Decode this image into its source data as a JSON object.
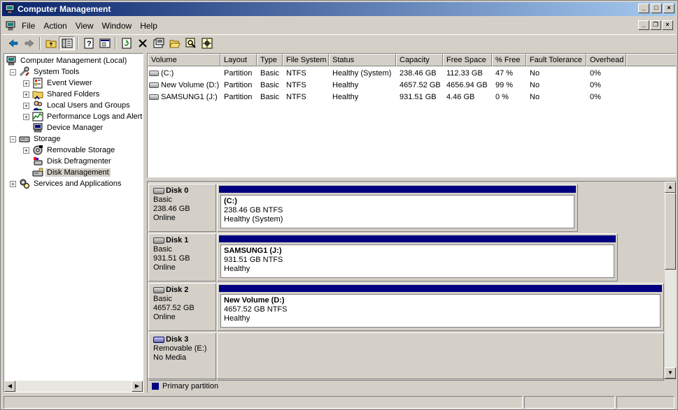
{
  "window": {
    "title": "Computer Management"
  },
  "menu": {
    "items": [
      {
        "label": "File"
      },
      {
        "label": "Action"
      },
      {
        "label": "View"
      },
      {
        "label": "Window"
      },
      {
        "label": "Help"
      }
    ]
  },
  "toolbar": {
    "icons": [
      "back-icon",
      "forward-icon",
      "up-folder-icon",
      "show-hide-tree-icon",
      "help-icon",
      "export-list-icon",
      "refresh-icon",
      "delete-icon",
      "properties-icon",
      "open-folder-icon",
      "search-icon",
      "settings-icon"
    ]
  },
  "tree": {
    "items": [
      {
        "label": "Computer Management (Local)",
        "level": 0,
        "expander": "",
        "icon": "computer-icon"
      },
      {
        "label": "System Tools",
        "level": 1,
        "expander": "−",
        "icon": "tools-icon"
      },
      {
        "label": "Event Viewer",
        "level": 2,
        "expander": "+",
        "icon": "event-viewer-icon"
      },
      {
        "label": "Shared Folders",
        "level": 2,
        "expander": "+",
        "icon": "shared-folder-icon"
      },
      {
        "label": "Local Users and Groups",
        "level": 2,
        "expander": "+",
        "icon": "users-icon"
      },
      {
        "label": "Performance Logs and Alerts",
        "level": 2,
        "expander": "+",
        "icon": "performance-icon"
      },
      {
        "label": "Device Manager",
        "level": 2,
        "expander": "",
        "icon": "device-manager-icon"
      },
      {
        "label": "Storage",
        "level": 1,
        "expander": "−",
        "icon": "storage-icon"
      },
      {
        "label": "Removable Storage",
        "level": 2,
        "expander": "+",
        "icon": "removable-storage-icon"
      },
      {
        "label": "Disk Defragmenter",
        "level": 2,
        "expander": "",
        "icon": "defragmenter-icon"
      },
      {
        "label": "Disk Management",
        "level": 2,
        "expander": "",
        "icon": "disk-management-icon",
        "selected": true
      },
      {
        "label": "Services and Applications",
        "level": 1,
        "expander": "+",
        "icon": "services-icon"
      }
    ]
  },
  "volume_list": {
    "columns": [
      "Volume",
      "Layout",
      "Type",
      "File System",
      "Status",
      "Capacity",
      "Free Space",
      "% Free",
      "Fault Tolerance",
      "Overhead"
    ],
    "rows": [
      [
        "(C:)",
        "Partition",
        "Basic",
        "NTFS",
        "Healthy (System)",
        "238.46 GB",
        "112.33 GB",
        "47 %",
        "No",
        "0%"
      ],
      [
        "New Volume (D:)",
        "Partition",
        "Basic",
        "NTFS",
        "Healthy",
        "4657.52 GB",
        "4656.94 GB",
        "99 %",
        "No",
        "0%"
      ],
      [
        "SAMSUNG1 (J:)",
        "Partition",
        "Basic",
        "NTFS",
        "Healthy",
        "931.51 GB",
        "4.46 GB",
        "0 %",
        "No",
        "0%"
      ]
    ]
  },
  "disks": [
    {
      "name": "Disk 0",
      "type": "Basic",
      "size": "238.46 GB",
      "state": "Online",
      "partition": {
        "name": "(C:)",
        "detail": "238.46 GB NTFS",
        "status": "Healthy (System)"
      }
    },
    {
      "name": "Disk 1",
      "type": "Basic",
      "size": "931.51 GB",
      "state": "Online",
      "partition": {
        "name": "SAMSUNG1  (J:)",
        "detail": "931.51 GB NTFS",
        "status": "Healthy"
      }
    },
    {
      "name": "Disk 2",
      "type": "Basic",
      "size": "4657.52 GB",
      "state": "Online",
      "partition": {
        "name": "New Volume  (D:)",
        "detail": "4657.52 GB NTFS",
        "status": "Healthy"
      }
    },
    {
      "name": "Disk 3",
      "type": "Removable (E:)",
      "size": "",
      "state": "No Media",
      "partition": null
    }
  ],
  "legend": {
    "label": "Primary partition",
    "color": "#000080"
  },
  "colors": {
    "titlebar_start": "#0a246a",
    "titlebar_end": "#a6caf0",
    "partition_bar": "#000080",
    "chrome": "#d4d0c8"
  }
}
